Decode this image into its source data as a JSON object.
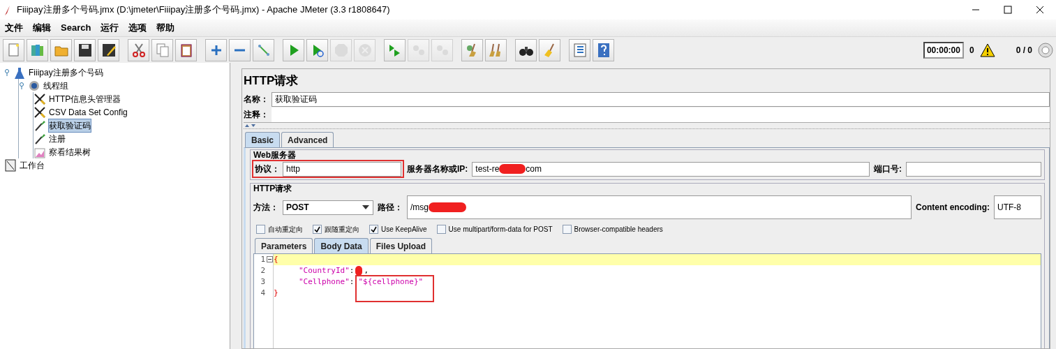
{
  "window": {
    "title": "Fiiipay注册多个号码.jmx (D:\\jmeter\\Fiiipay注册多个号码.jmx) - Apache JMeter (3.3 r1808647)"
  },
  "menu": [
    "文件",
    "编辑",
    "Search",
    "运行",
    "选项",
    "帮助"
  ],
  "toolbar": [
    [
      {
        "kind": "document",
        "disabled": false
      },
      {
        "kind": "books",
        "disabled": false
      },
      {
        "kind": "folder",
        "disabled": false
      },
      {
        "kind": "floppy",
        "disabled": false
      },
      {
        "kind": "floppy-pencil",
        "disabled": false
      }
    ],
    [
      {
        "kind": "scissors",
        "disabled": false
      },
      {
        "kind": "copy",
        "disabled": false
      },
      {
        "kind": "clipboard",
        "disabled": false
      }
    ],
    [
      {
        "kind": "plus",
        "disabled": false
      },
      {
        "kind": "minus",
        "disabled": false
      },
      {
        "kind": "probe",
        "disabled": false
      }
    ],
    [
      {
        "kind": "play",
        "disabled": false
      },
      {
        "kind": "play-circle",
        "disabled": false
      },
      {
        "kind": "stop",
        "disabled": true
      },
      {
        "kind": "x-circle",
        "disabled": true
      }
    ],
    [
      {
        "kind": "play-remote",
        "disabled": false
      },
      {
        "kind": "dots",
        "disabled": true
      },
      {
        "kind": "dots",
        "disabled": true
      }
    ],
    [
      {
        "kind": "broom-gear",
        "disabled": false
      },
      {
        "kind": "brooms",
        "disabled": false
      }
    ],
    [
      {
        "kind": "binoculars",
        "disabled": false
      },
      {
        "kind": "broom",
        "disabled": false
      }
    ],
    [
      {
        "kind": "list",
        "disabled": false
      },
      {
        "kind": "help",
        "disabled": false
      }
    ]
  ],
  "status": {
    "timer": "00:00:00",
    "errors": "0",
    "threads": "0 / 0"
  },
  "tree": [
    {
      "label": "Fiiipay注册多个号码",
      "kind": "flask",
      "selected": false,
      "expanded": true,
      "children": [
        {
          "label": "线程组",
          "kind": "gear",
          "selected": false,
          "expanded": true,
          "children": [
            {
              "label": "HTTP信息头管理器",
              "kind": "tools",
              "selected": false
            },
            {
              "label": "CSV Data Set Config",
              "kind": "tools",
              "selected": false
            },
            {
              "label": "获取验证码",
              "kind": "pipette",
              "selected": true
            },
            {
              "label": "注册",
              "kind": "pipette",
              "selected": false
            },
            {
              "label": "察看结果树",
              "kind": "chart",
              "selected": false
            }
          ]
        }
      ]
    },
    {
      "label": "工作台",
      "kind": "notepad",
      "selected": false
    }
  ],
  "panel": {
    "title": "HTTP请求",
    "name": {
      "label": "名称：",
      "value": "获取验证码"
    },
    "comment": {
      "label": "注释："
    },
    "tabs": [
      {
        "label": "Basic",
        "selected": true
      },
      {
        "label": "Advanced",
        "selected": false
      }
    ],
    "web_server": {
      "legend": "Web服务器",
      "protocol": {
        "label": "协议：",
        "value": "http",
        "highlighted": true
      },
      "host": {
        "label": "服务器名称或IP:",
        "value_start": "test-re",
        "value_end": "com",
        "redacted": true
      },
      "port": {
        "label": "端口号:"
      }
    },
    "http_request": {
      "legend": "HTTP请求",
      "method": {
        "label": "方法：",
        "value": "POST"
      },
      "path": {
        "label": "路径：",
        "value": "/msg",
        "redacted": true
      },
      "encoding": {
        "label": "Content encoding:",
        "value": "UTF-8"
      },
      "options": [
        {
          "label": "自动重定向",
          "checked": false
        },
        {
          "label": "跟随重定向",
          "checked": true
        },
        {
          "label": "Use KeepAlive",
          "checked": true
        },
        {
          "label": "Use multipart/form-data for POST",
          "checked": false
        },
        {
          "label": "Browser-compatible headers",
          "checked": false
        }
      ],
      "tabs": [
        {
          "label": "Parameters",
          "selected": false
        },
        {
          "label": "Body Data",
          "selected": true
        },
        {
          "label": "Files Upload",
          "selected": false
        }
      ],
      "body": [
        {
          "number": "1",
          "current": true,
          "foldable": true,
          "indented": false,
          "tokens": [
            {
              "kind": "brace",
              "text": "{"
            }
          ]
        },
        {
          "number": "2",
          "current": false,
          "foldable": false,
          "indented": true,
          "tokens": [
            {
              "kind": "key",
              "text": "\"CountryId\""
            },
            {
              "kind": "punct",
              "text": ":"
            },
            {
              "kind": "redaction"
            },
            {
              "kind": "punct",
              "text": ","
            }
          ]
        },
        {
          "number": "3",
          "current": false,
          "foldable": false,
          "indented": true,
          "tokens": [
            {
              "kind": "key",
              "text": "\"Cellphone\""
            },
            {
              "kind": "punct",
              "text": ":"
            },
            {
              "kind": "string",
              "text": "\"${cellphone}\"",
              "highlighted": true
            }
          ]
        },
        {
          "number": "4",
          "current": false,
          "foldable": false,
          "indented": false,
          "tokens": [
            {
              "kind": "brace",
              "text": "}"
            }
          ]
        }
      ]
    }
  }
}
